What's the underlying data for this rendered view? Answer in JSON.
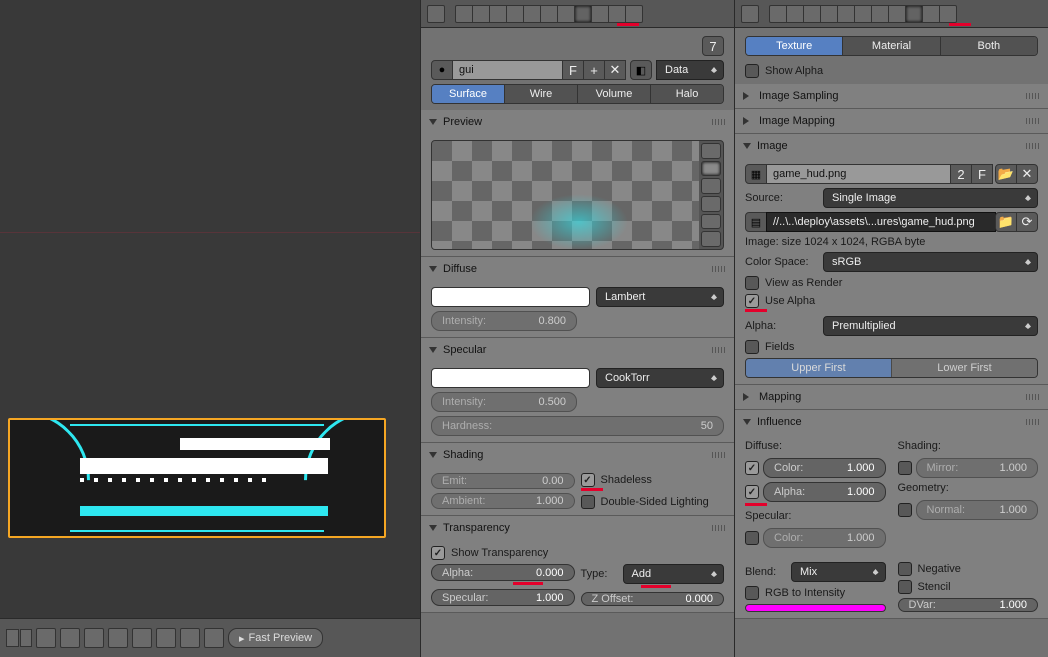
{
  "viewport": {
    "fast_preview": "Fast Preview"
  },
  "context_tabs_mid": [
    "render",
    "scene",
    "world",
    "object",
    "constraints",
    "modifiers",
    "data",
    "material",
    "texture",
    "particles",
    "physics"
  ],
  "context_active_mid": 7,
  "context_tabs_right": [
    "render",
    "scene",
    "world",
    "object",
    "constraints",
    "modifiers",
    "data",
    "material",
    "texture",
    "particles",
    "physics"
  ],
  "context_active_right": 8,
  "right_top_tabs": {
    "items": [
      "Texture",
      "Material",
      "Both"
    ],
    "active": 0
  },
  "material": {
    "pin_label": "F",
    "pin_num": "7",
    "name": "gui",
    "data_btn": "Data",
    "type_tabs": {
      "items": [
        "Surface",
        "Wire",
        "Volume",
        "Halo"
      ],
      "active": 0
    },
    "preview": "Preview",
    "diffuse": {
      "title": "Diffuse",
      "model": "Lambert",
      "intensity_lbl": "Intensity:",
      "intensity": "0.800",
      "color": "#ffffff"
    },
    "specular": {
      "title": "Specular",
      "model": "CookTorr",
      "intensity_lbl": "Intensity:",
      "intensity": "0.500",
      "hardness_lbl": "Hardness:",
      "hardness": "50",
      "color": "#ffffff"
    },
    "shading": {
      "title": "Shading",
      "emit_lbl": "Emit:",
      "emit": "0.00",
      "ambient_lbl": "Ambient:",
      "ambient": "1.000",
      "shadeless": "Shadeless",
      "double_sided": "Double-Sided Lighting"
    },
    "transparency": {
      "title": "Transparency",
      "show": "Show Transparency",
      "alpha_lbl": "Alpha:",
      "alpha": "0.000",
      "specular_lbl": "Specular:",
      "specular": "1.000",
      "type_lbl": "Type:",
      "type": "Add",
      "zoff_lbl": "Z Offset:",
      "zoff": "0.000"
    }
  },
  "texture": {
    "show_alpha": "Show Alpha",
    "sampling": "Image Sampling",
    "mapping_panel": "Image Mapping",
    "image_panel": {
      "title": "Image",
      "name": "game_hud.png",
      "users": "2",
      "fake": "F",
      "source_lbl": "Source:",
      "source": "Single Image",
      "path": "//..\\..\\deploy\\assets\\...ures\\game_hud.png",
      "info": "Image: size 1024 x 1024, RGBA byte",
      "colorspace_lbl": "Color Space:",
      "colorspace": "sRGB",
      "view_as_render": "View as Render",
      "use_alpha": "Use Alpha",
      "alpha_lbl": "Alpha:",
      "alpha_mode": "Premultiplied",
      "fields": "Fields",
      "upper": "Upper First",
      "lower": "Lower First"
    },
    "mapping": "Mapping",
    "influence": {
      "title": "Influence",
      "diffuse_hdr": "Diffuse:",
      "shading_hdr": "Shading:",
      "specular_hdr": "Specular:",
      "geometry_hdr": "Geometry:",
      "color_lbl": "Color:",
      "color_val": "1.000",
      "alpha_lbl": "Alpha:",
      "alpha_val": "1.000",
      "spec_color_lbl": "Color:",
      "spec_color_val": "1.000",
      "mirror_lbl": "Mirror:",
      "mirror_val": "1.000",
      "normal_lbl": "Normal:",
      "normal_val": "1.000",
      "blend_lbl": "Blend:",
      "blend": "Mix",
      "negative": "Negative",
      "rgb2i": "RGB to Intensity",
      "stencil": "Stencil",
      "color_swatch": "#ff00ff",
      "dvar_lbl": "DVar:",
      "dvar": "1.000"
    }
  }
}
